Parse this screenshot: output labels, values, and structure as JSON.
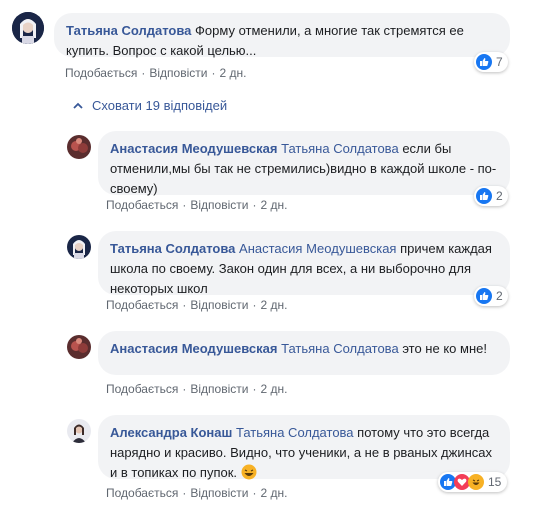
{
  "colors": {
    "link": "#385898",
    "bubble": "#f2f3f5",
    "muted": "#606770",
    "like": "#1877f2"
  },
  "actions": {
    "like": "Подобається",
    "reply": "Відповісти",
    "sep": "·"
  },
  "hide_replies": "Сховати 19 відповідей",
  "comments": [
    {
      "author": "Татьяна Солдатова",
      "mention": "",
      "text": "Форму отменили, а многие так стремятся ее купить. Вопрос с какой целью...",
      "time": "2 дн.",
      "reactions": "7"
    },
    {
      "author": "Анастасия Меодушевская",
      "mention": "Татьяна Солдатова",
      "text": "если бы отменили,мы бы так не стремились)видно в каждой школе - по-своему)",
      "time": "2 дн.",
      "reactions": "2"
    },
    {
      "author": "Татьяна Солдатова",
      "mention": "Анастасия Меодушевская",
      "text": "причем каждая школа по своему. Закон один для всех, а ни выборочно для некоторых школ",
      "time": "2 дн.",
      "reactions": "2"
    },
    {
      "author": "Анастасия Меодушевская",
      "mention": "Татьяна Солдатова",
      "text": "это не ко мне!",
      "time": "2 дн.",
      "reactions": ""
    },
    {
      "author": "Александра Конаш",
      "mention": "Татьяна Солдатова",
      "text": "потому что это всегда нарядно и красиво. Видно, что ученики, а не в рваных джинсах и в топиках по пупок.",
      "time": "2 дн.",
      "reactions": "15"
    }
  ]
}
